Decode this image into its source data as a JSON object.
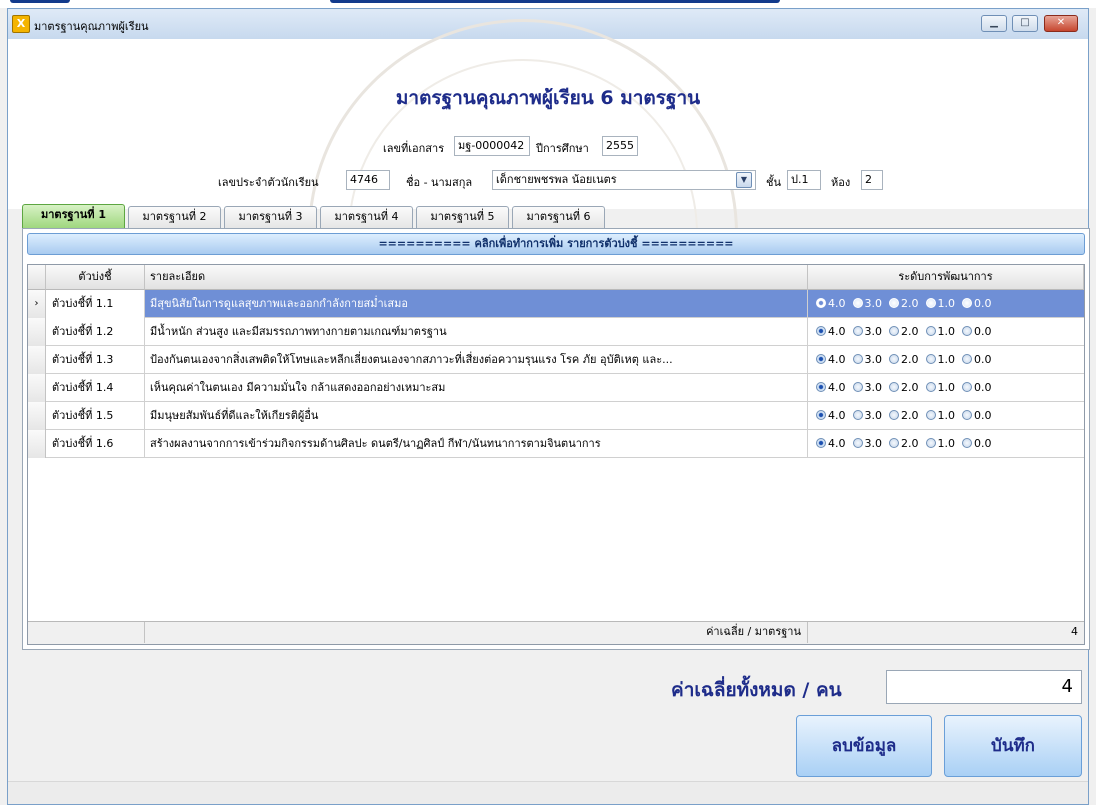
{
  "window": {
    "title": "มาตรฐานคุณภาพผู้เรียน",
    "app_icon": "app-icon"
  },
  "header": {
    "title": "มาตรฐานคุณภาพผู้เรียน 6 มาตรฐาน",
    "doc_no_label": "เลขที่เอกสาร",
    "doc_no": "มฐ-0000042",
    "year_label": "ปีการศึกษา",
    "year": "2555",
    "student_id_label": "เลขประจำตัวนักเรียน",
    "student_id": "4746",
    "name_label": "ชื่อ - นามสกุล",
    "name": "เด็กชายพชรพล น้อยเนตร",
    "class_label": "ชั้น",
    "class": "ป.1",
    "room_label": "ห้อง",
    "room": "2"
  },
  "tabs": [
    "มาตรฐานที่ 1",
    "มาตรฐานที่ 2",
    "มาตรฐานที่ 3",
    "มาตรฐานที่ 4",
    "มาตรฐานที่ 5",
    "มาตรฐานที่ 6"
  ],
  "active_tab": 0,
  "add_bar": "========== คลิกเพื่อทำการเพิ่ม รายการตัวบ่งชี้ ==========",
  "grid": {
    "headers": {
      "indicator": "ตัวบ่งชี้",
      "detail": "รายละเอียด",
      "level": "ระดับการพัฒนาการ"
    },
    "levels": [
      "4.0",
      "3.0",
      "2.0",
      "1.0",
      "0.0"
    ],
    "rows": [
      {
        "indicator": "ตัวบ่งชี้ที่ 1.1",
        "detail": "มีสุขนิสัยในการดูแลสุขภาพและออกกำลังกายสม่ำเสมอ",
        "selected": 0,
        "current": true
      },
      {
        "indicator": "ตัวบ่งชี้ที่ 1.2",
        "detail": " มีน้ำหนัก ส่วนสูง และมีสมรรถภาพทางกายตามเกณฑ์มาตรฐาน",
        "selected": 0,
        "current": false
      },
      {
        "indicator": "ตัวบ่งชี้ที่ 1.3",
        "detail": "ป้องกันตนเองจากสิ่งเสพติดให้โทษและหลีกเลี่ยงตนเองจากสภาวะที่เสี่ยงต่อความรุนแรง โรค ภัย อุบัติเหตุ และ...",
        "selected": 0,
        "current": false
      },
      {
        "indicator": "ตัวบ่งชี้ที่ 1.4",
        "detail": "เห็นคุณค่าในตนเอง มีความมั่นใจ กล้าแสดงออกอย่างเหมาะสม",
        "selected": 0,
        "current": false
      },
      {
        "indicator": "ตัวบ่งชี้ที่ 1.5",
        "detail": "มีมนุษยสัมพันธ์ที่ดีและให้เกียรติผู้อื่น",
        "selected": 0,
        "current": false
      },
      {
        "indicator": "ตัวบ่งชี้ที่ 1.6",
        "detail": "สร้างผลงานจากการเข้าร่วมกิจกรรมด้านศิลปะ ดนตรี/นาฏศิลป์ กีฬา/นันทนาการตามจินตนาการ",
        "selected": 0,
        "current": false
      }
    ],
    "avg_label": "ค่าเฉลี่ย / มาตรฐาน",
    "avg_value": "4"
  },
  "summary": {
    "label": "ค่าเฉลี่ยทั้งหมด / คน",
    "value": "4"
  },
  "buttons": {
    "delete": "ลบข้อมูล",
    "save": "บันทึก"
  }
}
